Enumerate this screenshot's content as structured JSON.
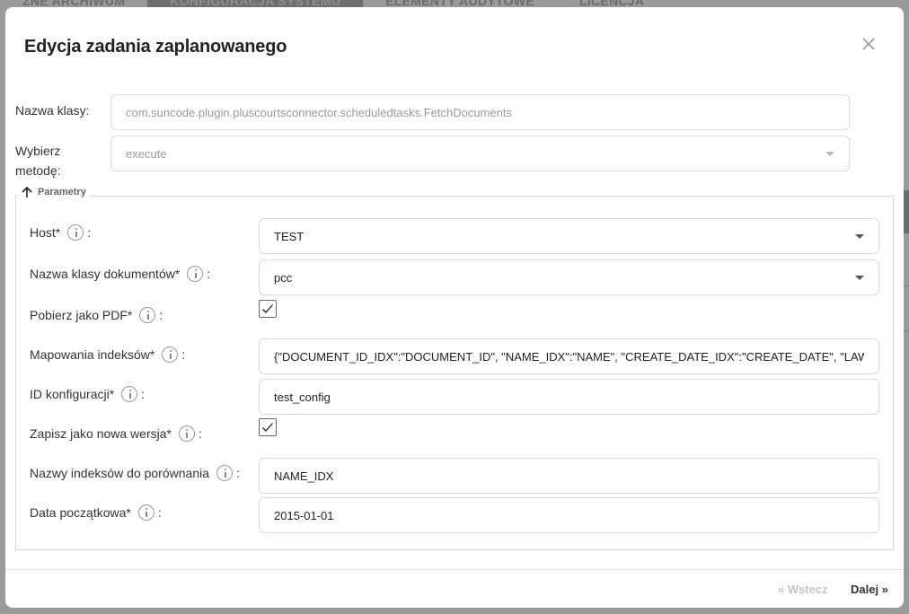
{
  "background": {
    "tabs": [
      "ZNE ARCHIWUM",
      "KONFIGURACJA SYSTEMU",
      "ELEMENTY AUDYTOWE",
      "LICENCJA"
    ]
  },
  "dialog": {
    "title": "Edycja zadania zaplanowanego",
    "class_label": "Nazwa klasy:",
    "class_value": "com.suncode.plugin.pluscourtsconnector.scheduledtasks.FetchDocuments",
    "method_label_line1": "Wybierz",
    "method_label_line2": "metodę:",
    "method_value": "execute",
    "params_legend": "Parametry",
    "params": {
      "host_label": "Host*",
      "host_value": "TEST",
      "doc_class_label": "Nazwa klasy dokumentów*",
      "doc_class_value": "pcc",
      "pdf_label": "Pobierz jako PDF*",
      "pdf_checked": true,
      "mapping_label": "Mapowania indeksów*",
      "mapping_value": "{\"DOCUMENT_ID_IDX\":\"DOCUMENT_ID\", \"NAME_IDX\":\"NAME\", \"CREATE_DATE_IDX\":\"CREATE_DATE\", \"LAWSUIT_I",
      "config_label": "ID konfiguracji*",
      "config_value": "test_config",
      "new_version_label": "Zapisz jako nowa wersja*",
      "new_version_checked": true,
      "compare_label": "Nazwy indeksów do porównania",
      "compare_value": "NAME_IDX",
      "start_date_label": "Data początkowa*",
      "start_date_value": "2015-01-01",
      "colon": ":"
    },
    "footer": {
      "prev_label": "« Wstecz",
      "next_label": "Dalej »"
    }
  }
}
